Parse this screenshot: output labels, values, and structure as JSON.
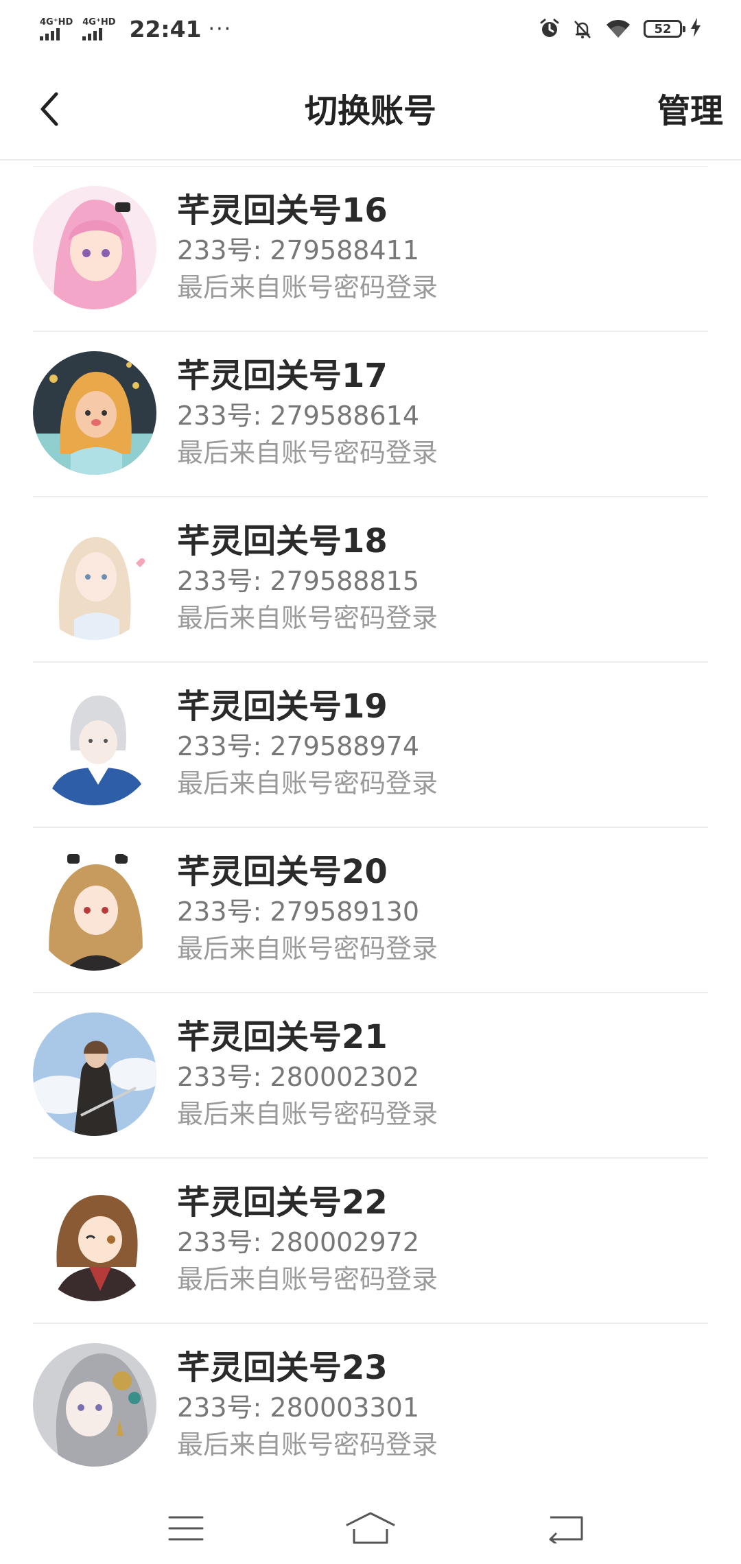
{
  "status_bar": {
    "signal1_label": "4G⁺HD",
    "signal2_label": "4G⁺HD",
    "time": "22:41",
    "dots": "···",
    "battery_level": "52"
  },
  "header": {
    "back_icon": "chevron-left-icon",
    "title": "切换账号",
    "manage_label": "管理"
  },
  "accounts": [
    {
      "name": "芊灵回关号16",
      "uid_label": "233号: ",
      "uid": "279588411",
      "last_login": "最后来自账号密码登录",
      "avatar_color": "#f2b8d4"
    },
    {
      "name": "芊灵回关号17",
      "uid_label": "233号: ",
      "uid": "279588614",
      "last_login": "最后来自账号密码登录",
      "avatar_color": "#3b4a52"
    },
    {
      "name": "芊灵回关号18",
      "uid_label": "233号: ",
      "uid": "279588815",
      "last_login": "最后来自账号密码登录",
      "avatar_color": "#f3ece6"
    },
    {
      "name": "芊灵回关号19",
      "uid_label": "233号: ",
      "uid": "279588974",
      "last_login": "最后来自账号密码登录",
      "avatar_color": "#e8e8ee"
    },
    {
      "name": "芊灵回关号20",
      "uid_label": "233号: ",
      "uid": "279589130",
      "last_login": "最后来自账号密码登录",
      "avatar_color": "#f1e4d2"
    },
    {
      "name": "芊灵回关号21",
      "uid_label": "233号: ",
      "uid": "280002302",
      "last_login": "最后来自账号密码登录",
      "avatar_color": "#a9c8e8"
    },
    {
      "name": "芊灵回关号22",
      "uid_label": "233号: ",
      "uid": "280002972",
      "last_login": "最后来自账号密码登录",
      "avatar_color": "#f5efe8"
    },
    {
      "name": "芊灵回关号23",
      "uid_label": "233号: ",
      "uid": "280003301",
      "last_login": "最后来自账号密码登录",
      "avatar_color": "#d8d8dc"
    }
  ],
  "nav_bar": {
    "menu_icon": "menu-icon",
    "home_icon": "home-icon",
    "back_icon": "back-icon"
  }
}
